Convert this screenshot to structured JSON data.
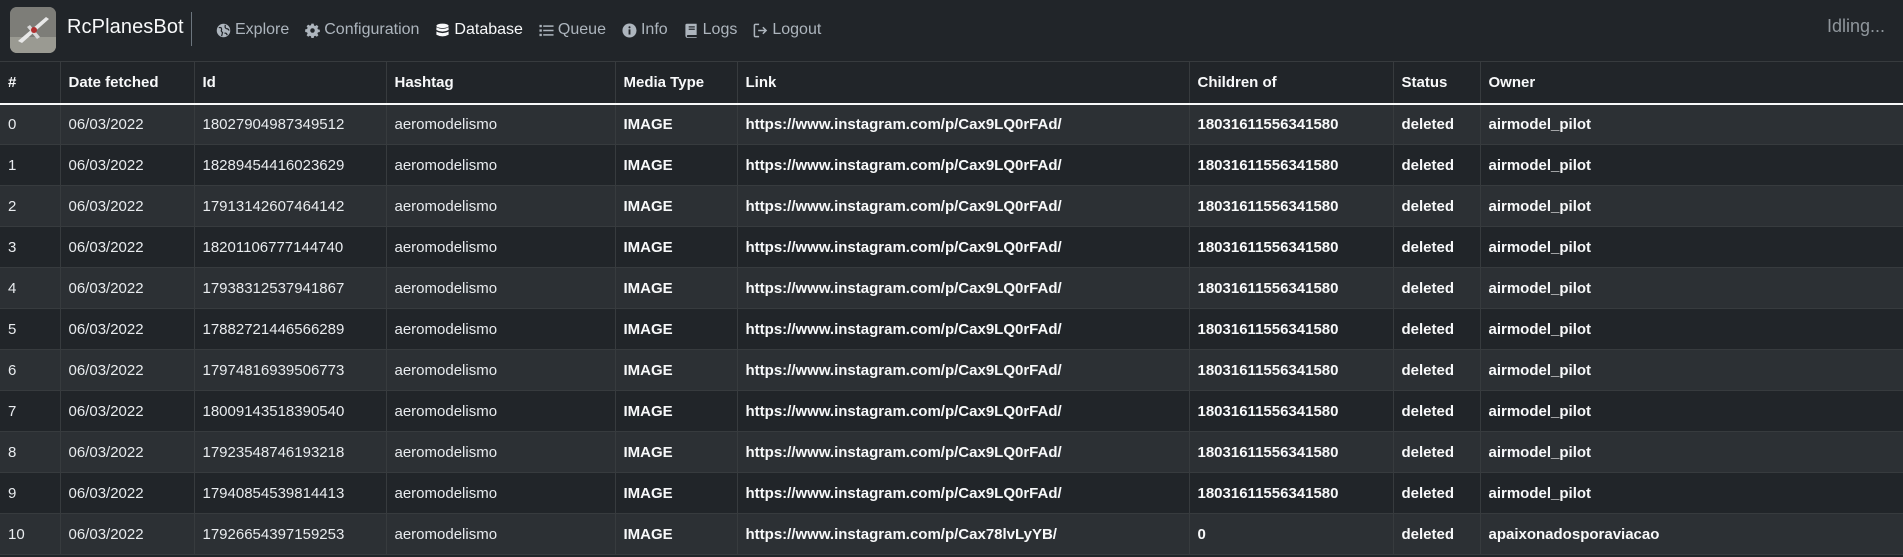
{
  "app": {
    "brand": "RcPlanesBot",
    "status": "Idling..."
  },
  "nav": [
    {
      "label": "Explore",
      "icon": "globe-icon",
      "active": false
    },
    {
      "label": "Configuration",
      "icon": "gear-icon",
      "active": false
    },
    {
      "label": "Database",
      "icon": "database-icon",
      "active": true
    },
    {
      "label": "Queue",
      "icon": "list-icon",
      "active": false
    },
    {
      "label": "Info",
      "icon": "info-icon",
      "active": false
    },
    {
      "label": "Logs",
      "icon": "book-icon",
      "active": false
    },
    {
      "label": "Logout",
      "icon": "logout-icon",
      "active": false
    }
  ],
  "table": {
    "headers": [
      "#",
      "Date fetched",
      "Id",
      "Hashtag",
      "Media Type",
      "Link",
      "Children of",
      "Status",
      "Owner"
    ],
    "rows": [
      [
        "0",
        "06/03/2022",
        "18027904987349512",
        "aeromodelismo",
        "IMAGE",
        "https://www.instagram.com/p/Cax9LQ0rFAd/",
        "18031611556341580",
        "deleted",
        "airmodel_pilot"
      ],
      [
        "1",
        "06/03/2022",
        "18289454416023629",
        "aeromodelismo",
        "IMAGE",
        "https://www.instagram.com/p/Cax9LQ0rFAd/",
        "18031611556341580",
        "deleted",
        "airmodel_pilot"
      ],
      [
        "2",
        "06/03/2022",
        "17913142607464142",
        "aeromodelismo",
        "IMAGE",
        "https://www.instagram.com/p/Cax9LQ0rFAd/",
        "18031611556341580",
        "deleted",
        "airmodel_pilot"
      ],
      [
        "3",
        "06/03/2022",
        "18201106777144740",
        "aeromodelismo",
        "IMAGE",
        "https://www.instagram.com/p/Cax9LQ0rFAd/",
        "18031611556341580",
        "deleted",
        "airmodel_pilot"
      ],
      [
        "4",
        "06/03/2022",
        "17938312537941867",
        "aeromodelismo",
        "IMAGE",
        "https://www.instagram.com/p/Cax9LQ0rFAd/",
        "18031611556341580",
        "deleted",
        "airmodel_pilot"
      ],
      [
        "5",
        "06/03/2022",
        "17882721446566289",
        "aeromodelismo",
        "IMAGE",
        "https://www.instagram.com/p/Cax9LQ0rFAd/",
        "18031611556341580",
        "deleted",
        "airmodel_pilot"
      ],
      [
        "6",
        "06/03/2022",
        "17974816939506773",
        "aeromodelismo",
        "IMAGE",
        "https://www.instagram.com/p/Cax9LQ0rFAd/",
        "18031611556341580",
        "deleted",
        "airmodel_pilot"
      ],
      [
        "7",
        "06/03/2022",
        "18009143518390540",
        "aeromodelismo",
        "IMAGE",
        "https://www.instagram.com/p/Cax9LQ0rFAd/",
        "18031611556341580",
        "deleted",
        "airmodel_pilot"
      ],
      [
        "8",
        "06/03/2022",
        "17923548746193218",
        "aeromodelismo",
        "IMAGE",
        "https://www.instagram.com/p/Cax9LQ0rFAd/",
        "18031611556341580",
        "deleted",
        "airmodel_pilot"
      ],
      [
        "9",
        "06/03/2022",
        "17940854539814413",
        "aeromodelismo",
        "IMAGE",
        "https://www.instagram.com/p/Cax9LQ0rFAd/",
        "18031611556341580",
        "deleted",
        "airmodel_pilot"
      ],
      [
        "10",
        "06/03/2022",
        "17926654397159253",
        "aeromodelismo",
        "IMAGE",
        "https://www.instagram.com/p/Cax78lvLyYB/",
        "0",
        "deleted",
        "apaixonadosporaviacao"
      ]
    ]
  }
}
